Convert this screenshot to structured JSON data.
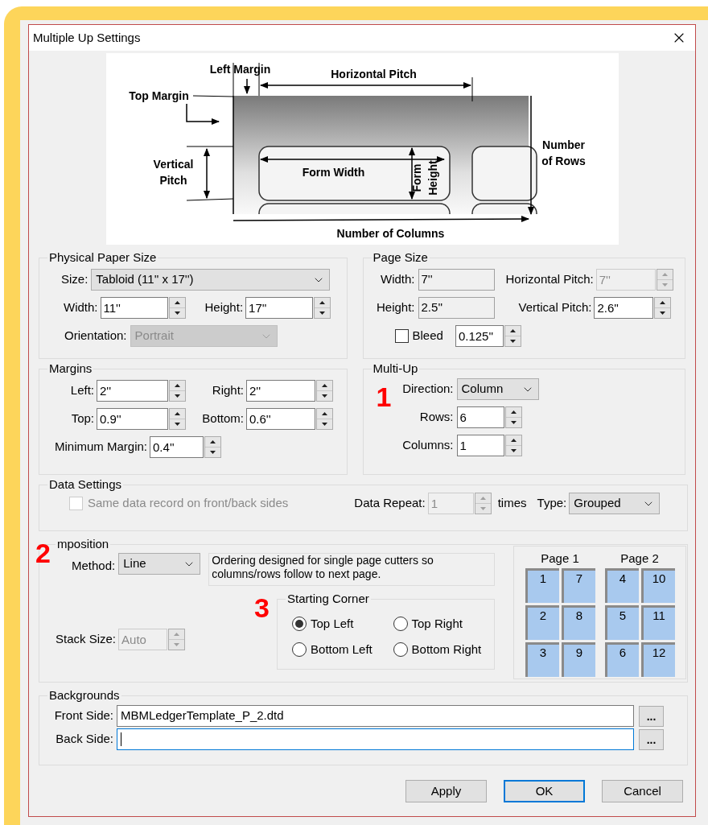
{
  "window": {
    "title": "Multiple Up Settings"
  },
  "diagram": {
    "labels": [
      {
        "kind": "left_margin",
        "text": "Left Margin"
      },
      {
        "kind": "horizontal_pitch",
        "text": "Horizontal Pitch"
      },
      {
        "kind": "top_margin",
        "text": "Top Margin"
      },
      {
        "kind": "vertical_pitch",
        "text": "Vertical Pitch"
      },
      {
        "kind": "form_width",
        "text": "Form Width"
      },
      {
        "kind": "form_height",
        "text": "Form Height"
      },
      {
        "kind": "number_of_rows",
        "text": "Number of Rows"
      },
      {
        "kind": "number_of_columns",
        "text": "Number of Columns"
      }
    ]
  },
  "physical_paper_size": {
    "title": "Physical Paper Size",
    "size": {
      "label": "Size:",
      "value": "Tabloid (11'' x 17'')",
      "disabled": false
    },
    "width": {
      "label": "Width:",
      "value": "11''",
      "disabled": false
    },
    "height": {
      "label": "Height:",
      "value": "17''",
      "disabled": false
    },
    "orientation": {
      "label": "Orientation:",
      "value": "Portrait",
      "disabled": true
    }
  },
  "page_size": {
    "title": "Page Size",
    "width": {
      "label": "Width:",
      "value": "7''"
    },
    "height": {
      "label": "Height:",
      "value": "2.5''"
    },
    "horizontal_pitch": {
      "label": "Horizontal Pitch:",
      "value": "7''",
      "disabled": true
    },
    "vertical_pitch": {
      "label": "Vertical Pitch:",
      "value": "2.6''",
      "disabled": false
    },
    "bleed": {
      "label": "Bleed",
      "checked": false,
      "disabled": false
    },
    "bleed_amount": {
      "value": "0.125''",
      "disabled": false
    }
  },
  "margins": {
    "title": "Margins",
    "left": {
      "label": "Left:",
      "value": "2''",
      "disabled": false
    },
    "right": {
      "label": "Right:",
      "value": "2''",
      "disabled": false
    },
    "top": {
      "label": "Top:",
      "value": "0.9''",
      "disabled": false
    },
    "bottom": {
      "label": "Bottom:",
      "value": "0.6''",
      "disabled": false
    },
    "minimum_margin": {
      "label": "Minimum Margin:",
      "value": "0.4''",
      "disabled": false
    }
  },
  "multi_up": {
    "title": "Multi-Up",
    "annotation": "1",
    "direction": {
      "label": "Direction:",
      "value": "Column",
      "disabled": false
    },
    "rows": {
      "label": "Rows:",
      "value": "6",
      "disabled": false
    },
    "columns": {
      "label": "Columns:",
      "value": "1",
      "disabled": false
    }
  },
  "data_settings": {
    "title": "Data Settings",
    "same_record": {
      "label": "Same data record on front/back sides",
      "checked": false,
      "disabled": true
    },
    "data_repeat": {
      "label": "Data Repeat:",
      "value": "1",
      "disabled": true
    },
    "times": "times",
    "type": {
      "label": "Type:",
      "value": "Grouped",
      "disabled": false
    }
  },
  "imposition": {
    "title": "mposition",
    "annotation": "2",
    "method": {
      "label": "Method:",
      "value": "Line",
      "disabled": false
    },
    "description": "Ordering designed for single page cutters so columns/rows follow to next page.",
    "stack_size": {
      "label": "Stack Size:",
      "value": "Auto",
      "disabled": true
    },
    "starting_corner": {
      "title": "Starting Corner",
      "annotation": "3",
      "options": [
        {
          "label": "Top Left",
          "selected": true
        },
        {
          "label": "Top Right",
          "selected": false
        },
        {
          "label": "Bottom Left",
          "selected": false
        },
        {
          "label": "Bottom Right",
          "selected": false
        }
      ]
    },
    "pages": [
      {
        "title": "Page 1",
        "cells": [
          "1",
          "7",
          "2",
          "8",
          "3",
          "9"
        ]
      },
      {
        "title": "Page 2",
        "cells": [
          "4",
          "10",
          "5",
          "11",
          "6",
          "12"
        ]
      }
    ]
  },
  "backgrounds": {
    "title": "Backgrounds",
    "front_side": {
      "label": "Front Side:",
      "value": "MBMLedgerTemplate_P_2.dtd",
      "focused": false,
      "browse": "..."
    },
    "back_side": {
      "label": "Back Side:",
      "focused": true,
      "browse": "..."
    }
  },
  "buttons": [
    {
      "label": "Apply",
      "default": false
    },
    {
      "label": "OK",
      "default": true
    },
    {
      "label": "Cancel",
      "default": false
    }
  ]
}
